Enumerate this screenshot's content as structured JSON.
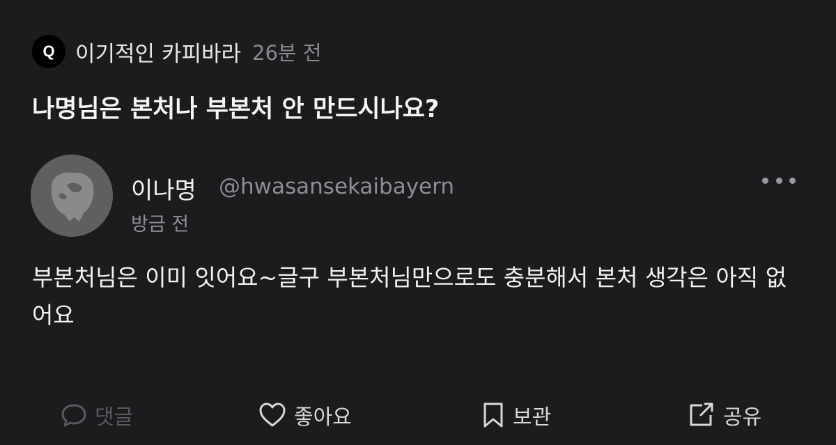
{
  "question": {
    "badge": "Q",
    "asker": "이기적인 카피바라",
    "time": "26분 전",
    "text": "나명님은 본처나 부본처 안 만드시나요?"
  },
  "answer": {
    "author_name": "이나명",
    "author_handle": "@hwasansekaibayern",
    "time": "방금 전",
    "text": "부본처님은 이미 잇어요~글구 부본처님만으로도 충분해서 본처 생각은 아직 없어요",
    "more_icon": "more-dots-icon"
  },
  "actions": {
    "comment_label": "댓글",
    "like_label": "좋아요",
    "bookmark_label": "보관",
    "share_label": "공유"
  },
  "colors": {
    "background": "#1c1c1e",
    "primary_text": "#f2f2f2",
    "secondary_text": "#8e8e93",
    "disabled_text": "#5a5a5e",
    "avatar_bg": "#5f5f5f"
  }
}
